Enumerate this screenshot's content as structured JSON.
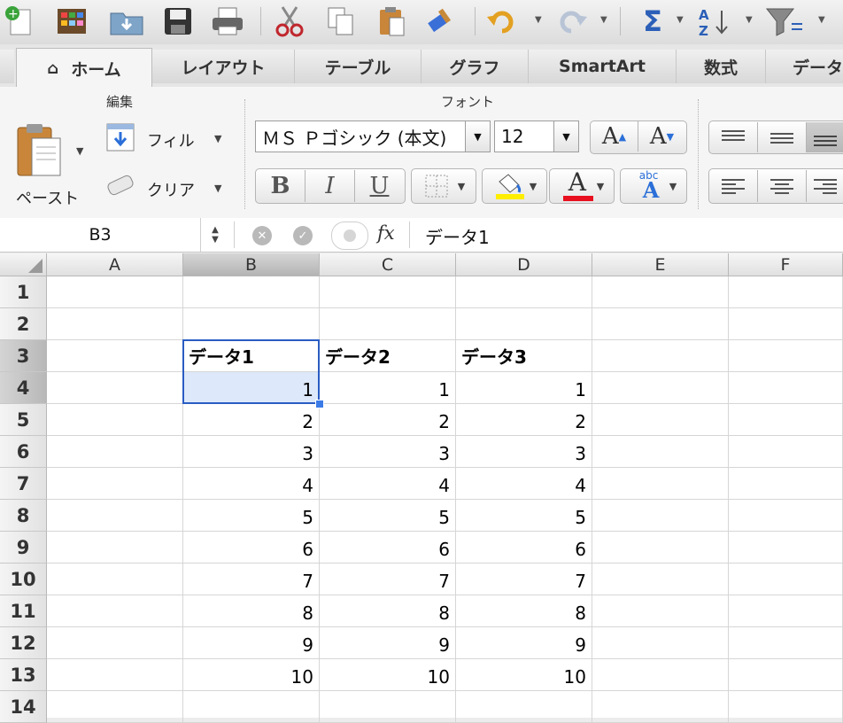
{
  "tabs": [
    "ホーム",
    "レイアウト",
    "テーブル",
    "グラフ",
    "SmartArt",
    "数式",
    "データ"
  ],
  "ribbon": {
    "edit_group": "編集",
    "font_group": "フォント",
    "paste": "ペースト",
    "fill": "フィル",
    "clear": "クリア",
    "font_name": "ＭＳ Ｐゴシック (本文)",
    "font_size": "12",
    "bold": "B",
    "italic": "I",
    "underline": "U",
    "abc": "abc",
    "font_color_letter": "A",
    "highlight_color": "#ffee00",
    "font_color": "#e8101f"
  },
  "formula_bar": {
    "name_box": "B3",
    "fx": "fx",
    "value": "データ1"
  },
  "sheet": {
    "columns": [
      "A",
      "B",
      "C",
      "D",
      "E",
      "F"
    ],
    "rows": [
      "1",
      "2",
      "3",
      "4",
      "5",
      "6",
      "7",
      "8",
      "9",
      "10",
      "11",
      "12",
      "13",
      "14"
    ],
    "headers": [
      "データ1",
      "データ2",
      "データ3"
    ],
    "data": [
      [
        "1",
        "1",
        "1"
      ],
      [
        "2",
        "2",
        "2"
      ],
      [
        "3",
        "3",
        "3"
      ],
      [
        "4",
        "4",
        "4"
      ],
      [
        "5",
        "5",
        "5"
      ],
      [
        "6",
        "6",
        "6"
      ],
      [
        "7",
        "7",
        "7"
      ],
      [
        "8",
        "8",
        "8"
      ],
      [
        "9",
        "9",
        "9"
      ],
      [
        "10",
        "10",
        "10"
      ]
    ]
  }
}
